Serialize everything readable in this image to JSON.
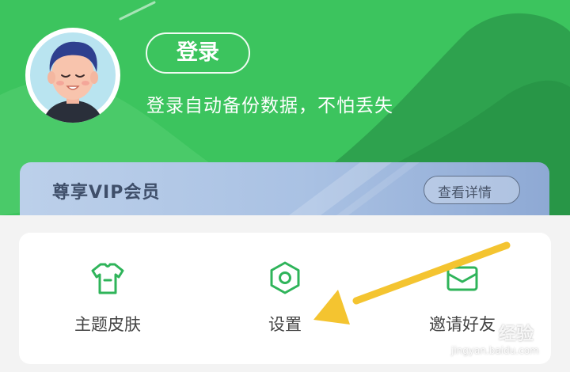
{
  "header": {
    "login_button": "登录",
    "login_subtitle": "登录自动备份数据，不怕丢失",
    "avatar_icon": "avatar-icon"
  },
  "vip": {
    "title": "尊享VIP会员",
    "detail_button": "查看详情",
    "detail_icon": "chevron-right-icon"
  },
  "menu": {
    "items": [
      {
        "label": "主题皮肤",
        "icon": "tshirt-icon"
      },
      {
        "label": "设置",
        "icon": "hexagon-settings-icon"
      },
      {
        "label": "邀请好友",
        "icon": "envelope-icon"
      }
    ]
  },
  "watermark": {
    "brand": "经验",
    "url": "jingyan.baidu.com"
  },
  "colors": {
    "header_green": "#3cc45e",
    "icon_green": "#2fb45a",
    "arrow_yellow": "#f4c430",
    "vip_blue": "#a9c1e3"
  }
}
